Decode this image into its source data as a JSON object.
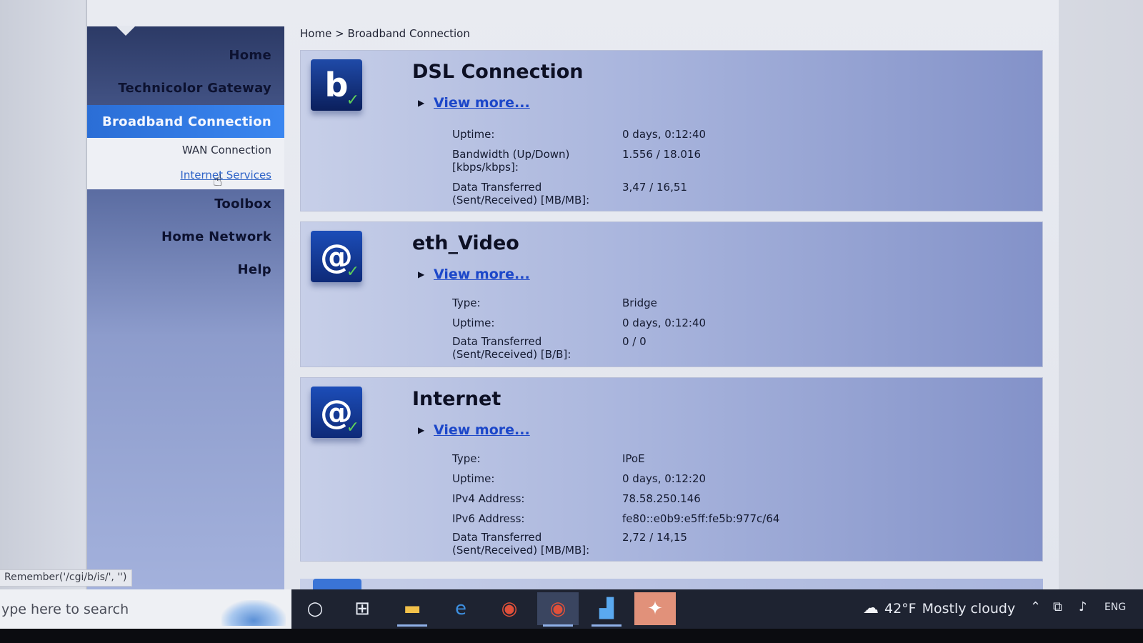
{
  "breadcrumb": {
    "home": "Home",
    "sep": ">",
    "current": "Broadband Connection"
  },
  "sidebar": {
    "home": "Home",
    "gateway": "Technicolor Gateway",
    "active": "Broadband Connection",
    "sub_wan": "WAN Connection",
    "sub_internet": "Internet Services",
    "toolbox": "Toolbox",
    "home_network": "Home Network",
    "help": "Help"
  },
  "cards": {
    "dsl": {
      "icon": "b",
      "title": "DSL Connection",
      "view_more": "View more...",
      "uptime_label": "Uptime:",
      "uptime": "0 days, 0:12:40",
      "bw_label_1": "Bandwidth (Up/Down)",
      "bw_label_2": "[kbps/kbps]:",
      "bw": "1.556 / 18.016",
      "dt_label_1": "Data Transferred",
      "dt_label_2": "(Sent/Received) [MB/MB]:",
      "dt": "3,47 / 16,51"
    },
    "eth": {
      "icon": "@",
      "title": "eth_Video",
      "view_more": "View more...",
      "type_label": "Type:",
      "type": "Bridge",
      "uptime_label": "Uptime:",
      "uptime": "0 days, 0:12:40",
      "dt_label_1": "Data Transferred",
      "dt_label_2": "(Sent/Received) [B/B]:",
      "dt": "0 / 0"
    },
    "internet": {
      "icon": "@",
      "title": "Internet",
      "view_more": "View more...",
      "type_label": "Type:",
      "type": "IPoE",
      "uptime_label": "Uptime:",
      "uptime": "0 days, 0:12:20",
      "ipv4_label": "IPv4 Address:",
      "ipv4": "78.58.250.146",
      "ipv6_label": "IPv6 Address:",
      "ipv6": "fe80::e0b9:e5ff:fe5b:977c/64",
      "dt_label_1": "Data Transferred",
      "dt_label_2": "(Sent/Received) [MB/MB]:",
      "dt": "2,72 / 14,15"
    }
  },
  "status_text": "Remember('/cgi/b/is/', '')",
  "taskbar": {
    "search_placeholder": "ype here to search",
    "weather_temp": "42°F",
    "weather_desc": "Mostly cloudy",
    "lang": "ENG"
  },
  "colors": {
    "accent": "#2b6ed6",
    "sidebar": "#53659b",
    "link": "#1c47c9"
  }
}
